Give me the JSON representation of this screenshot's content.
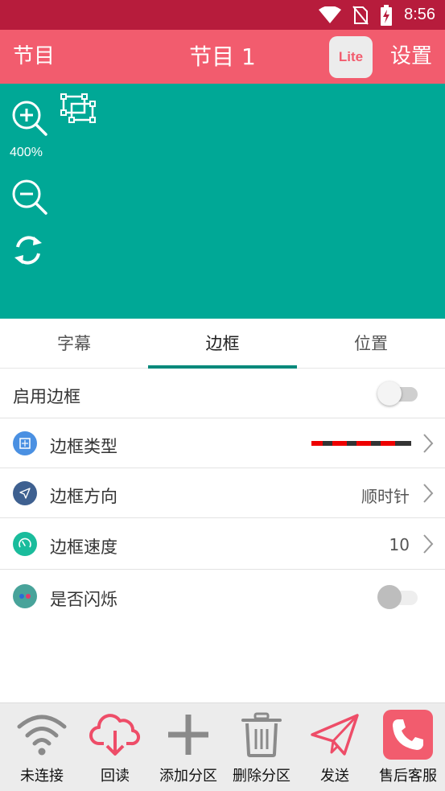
{
  "status_bar": {
    "time": "8:56"
  },
  "header": {
    "left_label": "节目",
    "title": "节目 1",
    "badge": "Lite",
    "right_label": "设置"
  },
  "canvas": {
    "zoom_level": "400%",
    "background": "#00a896"
  },
  "tabs": [
    {
      "label": "字幕",
      "active": false
    },
    {
      "label": "边框",
      "active": true
    },
    {
      "label": "位置",
      "active": false
    }
  ],
  "settings": {
    "enable_border": {
      "label": "启用边框",
      "on": false
    },
    "border_type": {
      "label": "边框类型"
    },
    "border_direction": {
      "label": "边框方向",
      "value": "顺时针"
    },
    "border_speed": {
      "label": "边框速度",
      "value": "10"
    },
    "blink": {
      "label": "是否闪烁",
      "on": false,
      "enabled": false
    }
  },
  "bottom_nav": [
    {
      "label": "未连接",
      "icon": "wifi-icon"
    },
    {
      "label": "回读",
      "icon": "cloud-download-icon"
    },
    {
      "label": "添加分区",
      "icon": "plus-icon"
    },
    {
      "label": "删除分区",
      "icon": "trash-icon"
    },
    {
      "label": "发送",
      "icon": "send-icon"
    },
    {
      "label": "售后客服",
      "icon": "phone-icon"
    }
  ],
  "colors": {
    "status_bar": "#b71c3c",
    "app_bar": "#f25c6e",
    "accent": "#00897b",
    "canvas": "#00a896"
  }
}
